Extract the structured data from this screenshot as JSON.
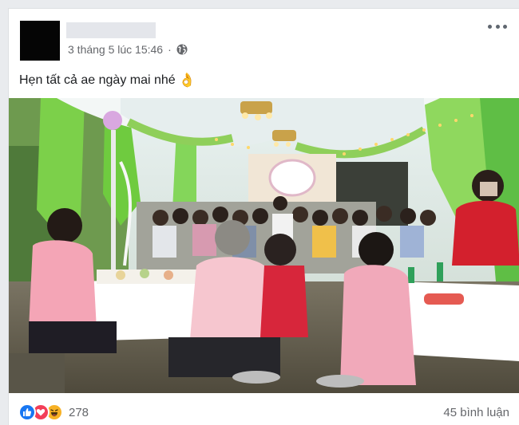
{
  "post": {
    "timestamp": "3 tháng 5 lúc 15:46",
    "privacy_icon": "globe-icon",
    "more_icon": "more-options-icon",
    "caption": "Hẹn tất cả ae ngày mai nhé",
    "caption_emoji": "👌",
    "photo_icon": "wedding-party-photo"
  },
  "footer": {
    "reaction_icons": [
      "like-icon",
      "love-icon",
      "haha-icon"
    ],
    "reaction_count": "278",
    "comment_count": "45 bình luận"
  },
  "colors": {
    "like": "#1877f2",
    "love": "#f33e58",
    "haha": "#f7b125",
    "meta_text": "#65676b"
  }
}
